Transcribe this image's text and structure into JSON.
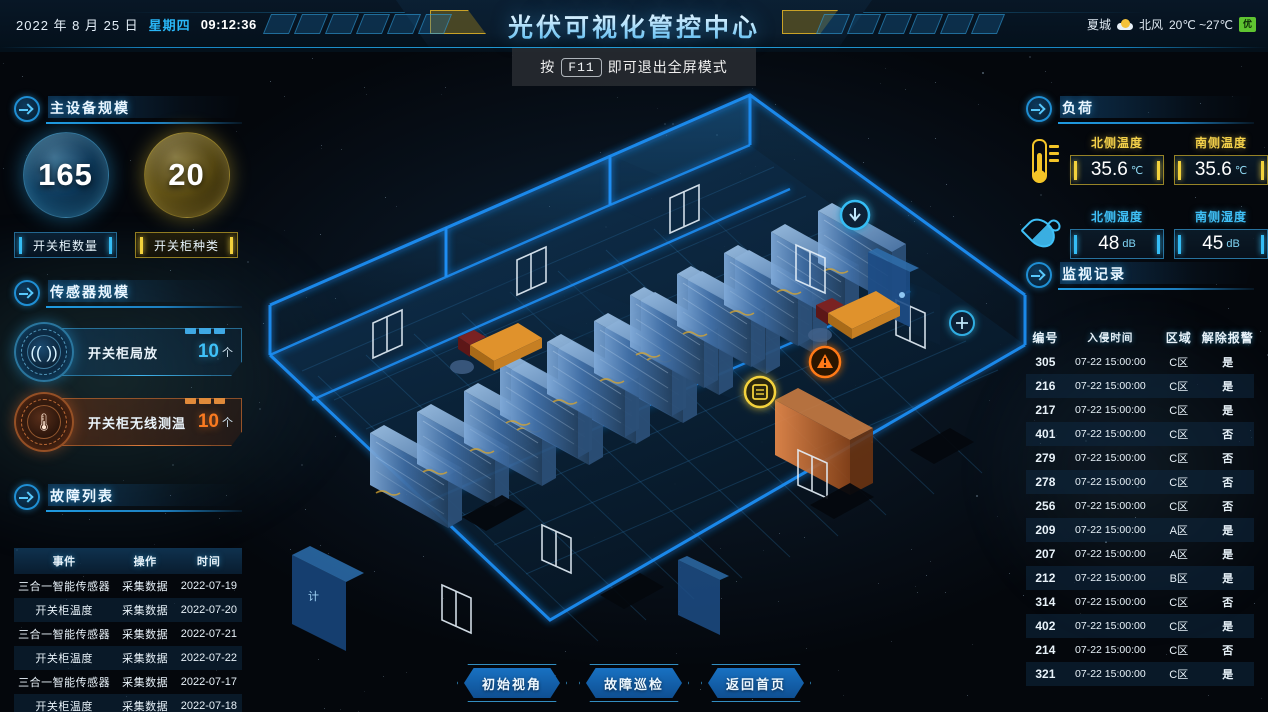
{
  "header": {
    "date": "2022 年 8 月 25 日",
    "weekday": "星期四",
    "time": "09:12:36",
    "title": "光伏可视化管控中心",
    "weather": {
      "city": "夏城",
      "icon": "cloud-sun-icon",
      "wind": "北风",
      "temp_range": "20℃ ~27℃",
      "air_badge": "优"
    }
  },
  "fullscreen_tip": {
    "prefix": "按",
    "key": "F11",
    "suffix": "即可退出全屏模式"
  },
  "left": {
    "device_scale": {
      "title": "主设备规模",
      "items": [
        {
          "value": "165",
          "label": "开关柜数量",
          "color": "#35bdf5"
        },
        {
          "value": "20",
          "label": "开关柜种类",
          "color": "#f3d23c"
        }
      ]
    },
    "sensor_scale": {
      "title": "传感器规模",
      "items": [
        {
          "label": "开关柜局放",
          "value": "10",
          "unit": "个",
          "color": "#3fc0f7",
          "icon": "wifi-signal-icon"
        },
        {
          "label": "开关柜无线测温",
          "value": "10",
          "unit": "个",
          "color": "#f97a20",
          "icon": "thermometer-wireless-icon"
        }
      ]
    },
    "fault_list": {
      "title": "故障列表",
      "columns": [
        "事件",
        "操作",
        "时间"
      ],
      "rows": [
        [
          "三合一智能传感器",
          "采集数据",
          "2022-07-19"
        ],
        [
          "开关柜温度",
          "采集数据",
          "2022-07-20"
        ],
        [
          "三合一智能传感器",
          "采集数据",
          "2022-07-21"
        ],
        [
          "开关柜温度",
          "采集数据",
          "2022-07-22"
        ],
        [
          "三合一智能传感器",
          "采集数据",
          "2022-07-17"
        ],
        [
          "开关柜温度",
          "采集数据",
          "2022-07-18"
        ]
      ]
    }
  },
  "right": {
    "load": {
      "title": "负荷",
      "temperature": {
        "icon": "thermometer-icon",
        "north": {
          "label": "北侧温度",
          "value": "35.6",
          "unit": "℃"
        },
        "south": {
          "label": "南侧温度",
          "value": "35.6",
          "unit": "℃"
        }
      },
      "humidity": {
        "icon": "water-drop-icon",
        "north": {
          "label": "北侧湿度",
          "value": "48",
          "unit": "dB"
        },
        "south": {
          "label": "南侧湿度",
          "value": "45",
          "unit": "dB"
        }
      }
    },
    "monitor_log": {
      "title": "监视记录",
      "columns": [
        "编号",
        "入侵时间",
        "区域",
        "解除报警"
      ],
      "rows": [
        [
          "305",
          "07-22 15:00:00",
          "C区",
          "是"
        ],
        [
          "216",
          "07-22 15:00:00",
          "C区",
          "是"
        ],
        [
          "217",
          "07-22 15:00:00",
          "C区",
          "是"
        ],
        [
          "401",
          "07-22 15:00:00",
          "C区",
          "否"
        ],
        [
          "279",
          "07-22 15:00:00",
          "C区",
          "否"
        ],
        [
          "278",
          "07-22 15:00:00",
          "C区",
          "否"
        ],
        [
          "256",
          "07-22 15:00:00",
          "C区",
          "否"
        ],
        [
          "209",
          "07-22 15:00:00",
          "A区",
          "是"
        ],
        [
          "207",
          "07-22 15:00:00",
          "A区",
          "是"
        ],
        [
          "212",
          "07-22 15:00:00",
          "B区",
          "是"
        ],
        [
          "314",
          "07-22 15:00:00",
          "C区",
          "否"
        ],
        [
          "402",
          "07-22 15:00:00",
          "C区",
          "是"
        ],
        [
          "214",
          "07-22 15:00:00",
          "C区",
          "否"
        ],
        [
          "321",
          "07-22 15:00:00",
          "C区",
          "是"
        ]
      ]
    }
  },
  "bottom_buttons": [
    {
      "label": "初始视角"
    },
    {
      "label": "故障巡检"
    },
    {
      "label": "返回首页"
    }
  ],
  "scene": {
    "markers": [
      {
        "name": "alarm-marker",
        "type": "warning",
        "color": "#ff7a18"
      },
      {
        "name": "sensor-marker-yellow",
        "type": "meter",
        "color": "#f3d23c"
      },
      {
        "name": "sensor-marker-blue-1",
        "type": "download",
        "color": "#35bdf5"
      },
      {
        "name": "sensor-marker-blue-2",
        "type": "plus",
        "color": "#35bdf5"
      }
    ]
  },
  "colors": {
    "accent_blue": "#29b6f6",
    "accent_yellow": "#f3d23c",
    "accent_orange": "#f97a20",
    "alarm_red": "#e8342a",
    "bg": "#04070d"
  }
}
